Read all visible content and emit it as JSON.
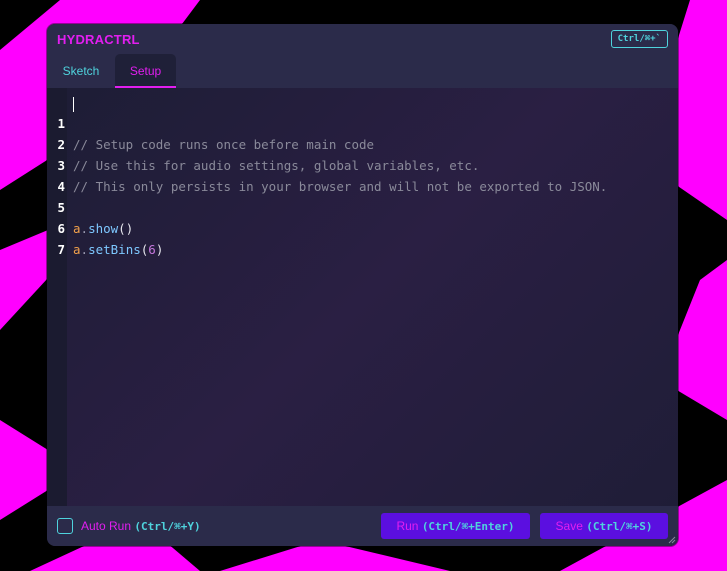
{
  "app": {
    "title": "HYDRACTRL",
    "shortcut": "Ctrl/⌘+`"
  },
  "tabs": [
    {
      "label": "Sketch",
      "active": false
    },
    {
      "label": "Setup",
      "active": true
    }
  ],
  "editor": {
    "lines": [
      {
        "num": "1",
        "text": "// Setup code runs once before main code"
      },
      {
        "num": "2",
        "text": "// Use this for audio settings, global variables, etc."
      },
      {
        "num": "3",
        "text": "// This only persists in your browser and will not be exported to JSON."
      },
      {
        "num": "4",
        "text": ""
      },
      {
        "num": "5",
        "obj": "a",
        "dot": ".",
        "method": "show",
        "open": "(",
        "arg": "",
        "close": ")"
      },
      {
        "num": "6",
        "obj": "a",
        "dot": ".",
        "method": "setBins",
        "open": "(",
        "arg": "6",
        "close": ")"
      },
      {
        "num": "7",
        "text": ""
      }
    ]
  },
  "footer": {
    "auto_run_label": "Auto Run",
    "auto_run_shortcut": "(Ctrl/⌘+Y)",
    "auto_run_checked": false,
    "run_label": "Run",
    "run_shortcut": "(Ctrl/⌘+Enter)",
    "save_label": "Save",
    "save_shortcut": "(Ctrl/⌘+S)"
  },
  "colors": {
    "accent_magenta": "#e21ef0",
    "accent_cyan": "#4fd3dd",
    "button_bg": "#5b0fe0",
    "panel_bg": "#1c1d33"
  }
}
